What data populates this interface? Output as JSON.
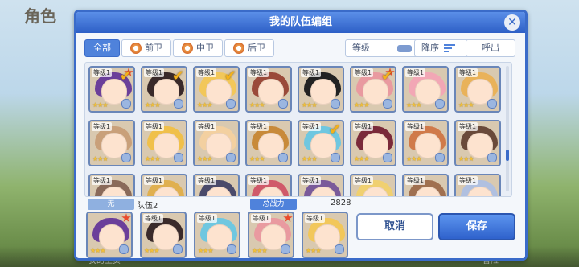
{
  "background": {
    "title": "角色",
    "bottom_left": "我的主页",
    "bottom_right": "冒险"
  },
  "dialog": {
    "title": "我的队伍编组",
    "filters": [
      "全部",
      "前卫",
      "中卫",
      "后卫"
    ],
    "active_filter": "全部",
    "sort_field": "等级",
    "sort_order": "降序",
    "call_label": "呼出",
    "level_label": "等级1",
    "accent_color": "#3a6bc9",
    "grid": [
      {
        "hair": "#6b3f9a",
        "checked": true,
        "rank": true
      },
      {
        "hair": "#3a2a2a",
        "checked": true,
        "rank": false
      },
      {
        "hair": "#f2c75a",
        "checked": true,
        "rank": false
      },
      {
        "hair": "#9a4a3a",
        "checked": false,
        "rank": false
      },
      {
        "hair": "#222222",
        "checked": false,
        "rank": false
      },
      {
        "hair": "#e99aa0",
        "checked": true,
        "rank": true
      },
      {
        "hair": "#f2a7b5",
        "checked": false,
        "rank": false
      },
      {
        "hair": "#e9b25a",
        "checked": false,
        "rank": false
      },
      {
        "hair": "#c9a07a",
        "checked": false,
        "rank": false
      },
      {
        "hair": "#f0c04a",
        "checked": false,
        "rank": false
      },
      {
        "hair": "#f3d0a0",
        "checked": false,
        "rank": false
      },
      {
        "hair": "#c88a3a",
        "checked": false,
        "rank": false
      },
      {
        "hair": "#6fc7e0",
        "checked": true,
        "rank": false
      },
      {
        "hair": "#7a2a3a",
        "checked": false,
        "rank": false
      },
      {
        "hair": "#d07a4a",
        "checked": false,
        "rank": false
      },
      {
        "hair": "#6a4a3a",
        "checked": false,
        "rank": false
      },
      {
        "hair": "#8a6a5a",
        "checked": false,
        "rank": false
      },
      {
        "hair": "#e0b050",
        "checked": false,
        "rank": false
      },
      {
        "hair": "#4a4a6a",
        "checked": false,
        "rank": false
      },
      {
        "hair": "#d05a6a",
        "checked": false,
        "rank": false
      },
      {
        "hair": "#7a5a9a",
        "checked": false,
        "rank": false
      },
      {
        "hair": "#f0d070",
        "checked": false,
        "rank": false
      },
      {
        "hair": "#a07050",
        "checked": false,
        "rank": false
      },
      {
        "hair": "#b0c0e0",
        "checked": false,
        "rank": false
      }
    ],
    "team": {
      "label": "无",
      "name": "队伍2",
      "power_label": "总战力",
      "power_value": "2828",
      "members": [
        {
          "hair": "#6b3f9a",
          "rank": true
        },
        {
          "hair": "#3a2a2a",
          "rank": false
        },
        {
          "hair": "#6fc7e0",
          "rank": false
        },
        {
          "hair": "#e99aa0",
          "rank": true
        },
        {
          "hair": "#f2c75a",
          "rank": false
        }
      ]
    },
    "cancel_label": "取消",
    "save_label": "保存"
  }
}
